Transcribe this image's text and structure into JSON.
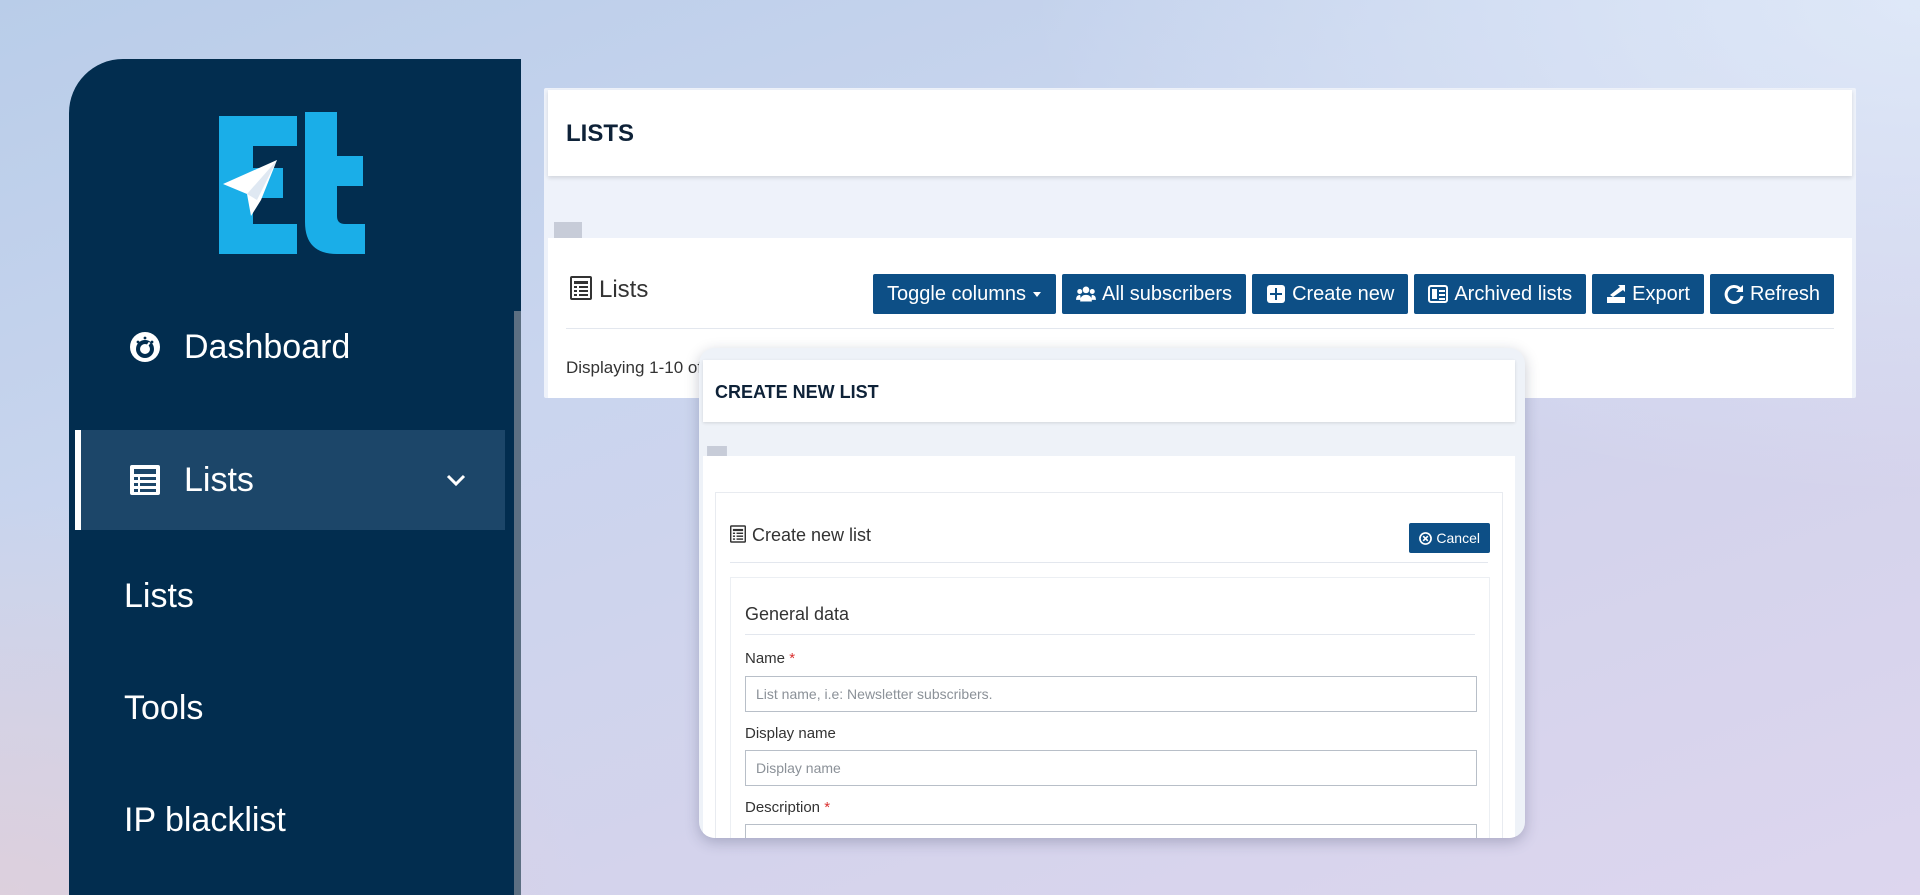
{
  "sidebar": {
    "logo_alt": "Et",
    "items": [
      {
        "label": "Dashboard",
        "icon": "dashboard-gauge-icon"
      },
      {
        "label": "Lists",
        "icon": "list-icon",
        "active": true,
        "expandable": true
      },
      {
        "label": "Lists"
      },
      {
        "label": "Tools"
      },
      {
        "label": "IP blacklist"
      }
    ]
  },
  "page": {
    "title": "LISTS"
  },
  "lists_card": {
    "title": "Lists",
    "toolbar": {
      "toggle_columns": "Toggle columns",
      "all_subscribers": "All subscribers",
      "create_new": "Create new",
      "archived_lists": "Archived lists",
      "export": "Export",
      "refresh": "Refresh"
    },
    "display_text": "Displaying 1-10 of"
  },
  "modal": {
    "title": "CREATE NEW LIST",
    "form_title": "Create new list",
    "cancel_label": "Cancel",
    "section_title": "General data",
    "fields": {
      "name": {
        "label": "Name",
        "required_mark": "*",
        "placeholder": "List name, i.e: Newsletter subscribers.",
        "value": ""
      },
      "display_name": {
        "label": "Display name",
        "placeholder": "Display name",
        "value": ""
      },
      "description": {
        "label": "Description",
        "required_mark": "*",
        "placeholder": "",
        "value": ""
      }
    }
  },
  "colors": {
    "sidebar_bg": "#022d4f",
    "sidebar_active": "#1c4669",
    "button_bg": "#0d4f86",
    "logo_cyan": "#1aaee8",
    "required": "#d9302f"
  }
}
